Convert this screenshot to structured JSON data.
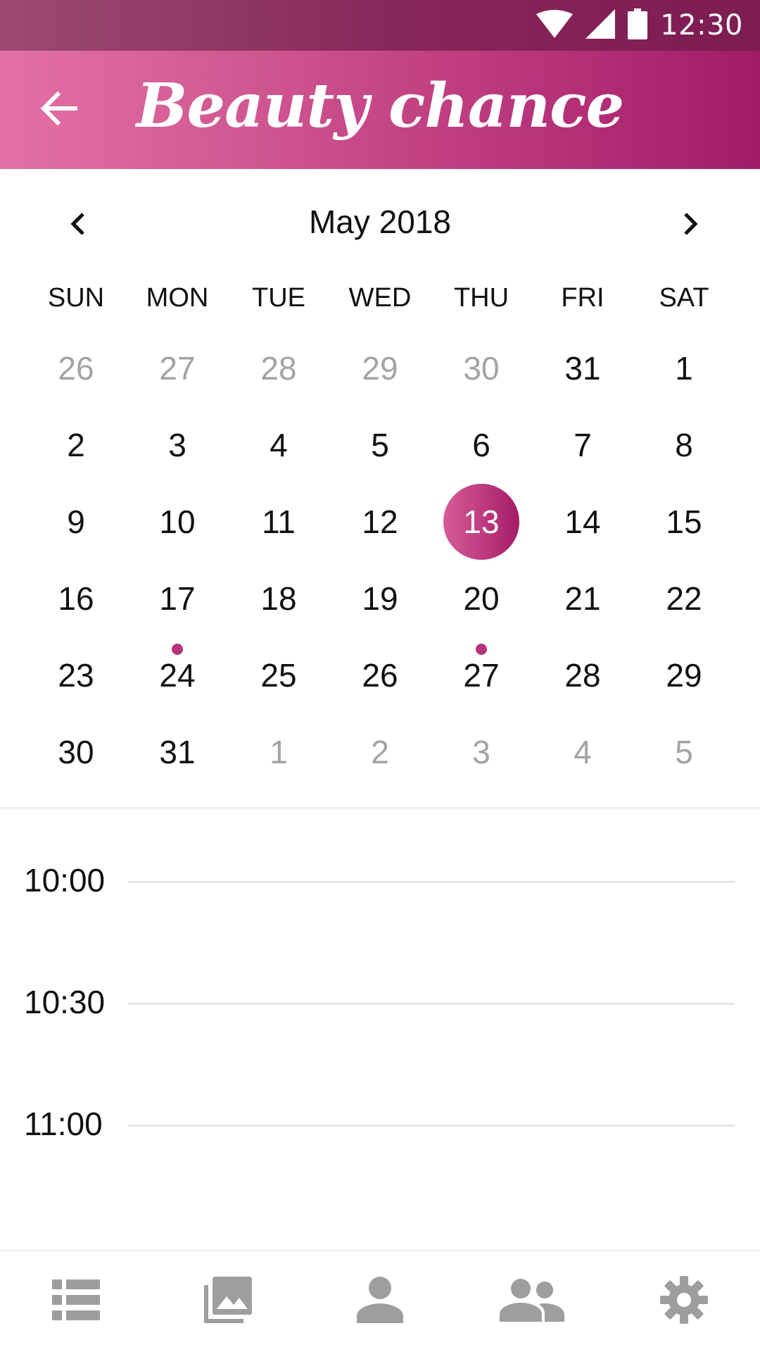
{
  "status_bar": {
    "time": "12:30",
    "icons": [
      "wifi-icon",
      "signal-icon",
      "battery-icon"
    ]
  },
  "app_bar": {
    "title": "Beauty chance",
    "back_icon": "arrow-left-icon"
  },
  "calendar": {
    "month_label": "May 2018",
    "prev_icon": "chevron-left-icon",
    "next_icon": "chevron-right-icon",
    "weekdays": [
      "SUN",
      "MON",
      "TUE",
      "WED",
      "THU",
      "FRI",
      "SAT"
    ],
    "days": [
      {
        "label": "26",
        "other": true
      },
      {
        "label": "27",
        "other": true
      },
      {
        "label": "28",
        "other": true
      },
      {
        "label": "29",
        "other": true
      },
      {
        "label": "30",
        "other": true
      },
      {
        "label": "31"
      },
      {
        "label": "1"
      },
      {
        "label": "2"
      },
      {
        "label": "3"
      },
      {
        "label": "4"
      },
      {
        "label": "5"
      },
      {
        "label": "6"
      },
      {
        "label": "7"
      },
      {
        "label": "8"
      },
      {
        "label": "9"
      },
      {
        "label": "10"
      },
      {
        "label": "11"
      },
      {
        "label": "12"
      },
      {
        "label": "13",
        "selected": true
      },
      {
        "label": "14"
      },
      {
        "label": "15"
      },
      {
        "label": "16"
      },
      {
        "label": "17"
      },
      {
        "label": "18"
      },
      {
        "label": "19"
      },
      {
        "label": "20"
      },
      {
        "label": "21"
      },
      {
        "label": "22"
      },
      {
        "label": "23"
      },
      {
        "label": "24",
        "event": true
      },
      {
        "label": "25"
      },
      {
        "label": "26"
      },
      {
        "label": "27",
        "event": true
      },
      {
        "label": "28"
      },
      {
        "label": "29"
      },
      {
        "label": "30"
      },
      {
        "label": "31"
      },
      {
        "label": "1",
        "other": true
      },
      {
        "label": "2",
        "other": true
      },
      {
        "label": "3",
        "other": true
      },
      {
        "label": "4",
        "other": true
      },
      {
        "label": "5",
        "other": true
      }
    ]
  },
  "schedule": {
    "slots": [
      "10:00",
      "10:30",
      "11:00"
    ]
  },
  "bottom_nav": {
    "items": [
      "list-icon",
      "photo-library-icon",
      "person-icon",
      "people-icon",
      "settings-icon"
    ]
  },
  "colors": {
    "accent": "#b8347a",
    "accent_dark": "#a21b67",
    "muted_text": "#a3a3a3",
    "nav_icon": "#9e9e9e"
  }
}
